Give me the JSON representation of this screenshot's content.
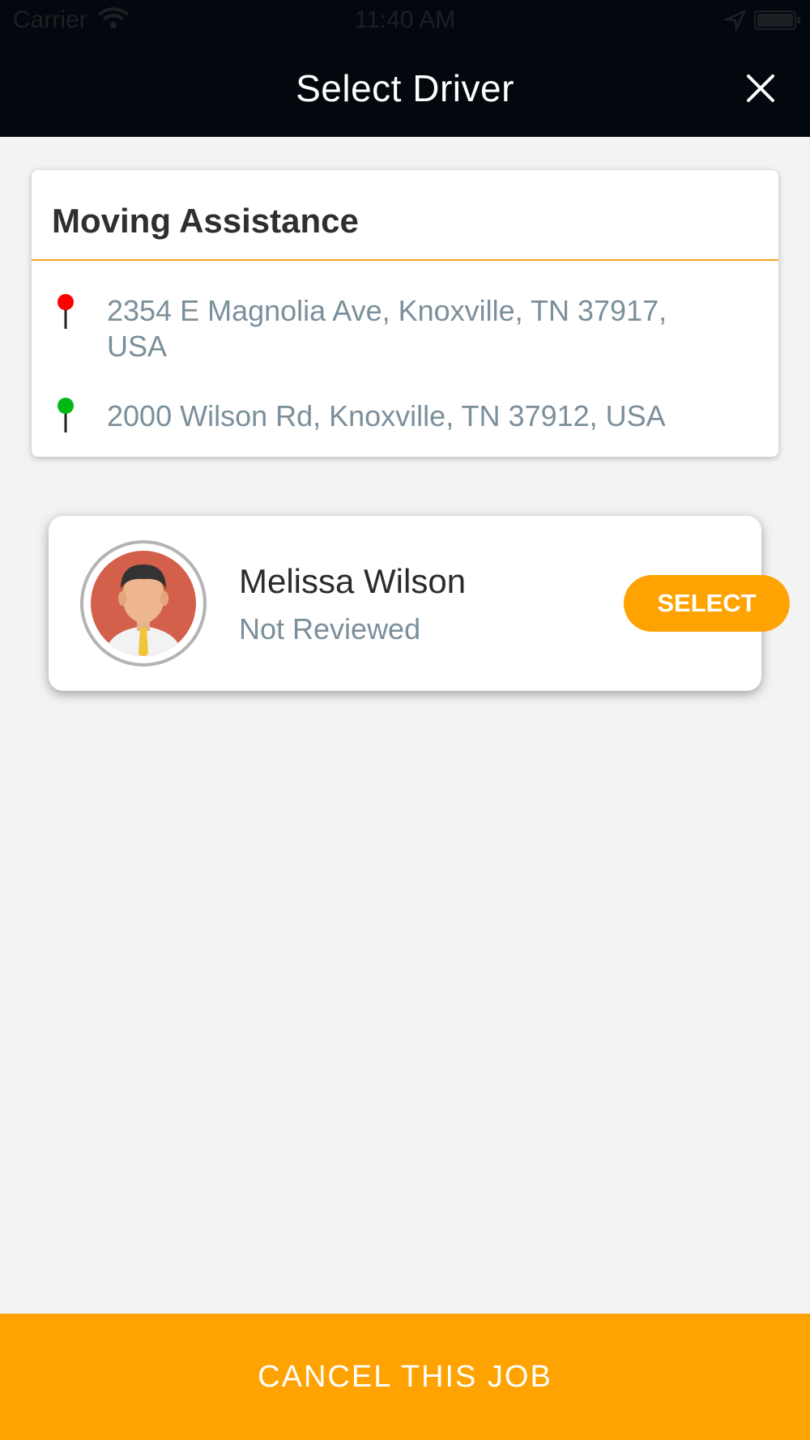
{
  "status_bar": {
    "carrier": "Carrier",
    "time": "11:40 AM"
  },
  "nav": {
    "title": "Select Driver"
  },
  "job": {
    "title": "Moving Assistance",
    "pickup_address": "2354 E Magnolia Ave, Knoxville, TN 37917, USA",
    "dropoff_address": "2000 Wilson Rd, Knoxville, TN 37912, USA"
  },
  "driver": {
    "name": "Melissa Wilson",
    "status": "Not Reviewed",
    "select_label": "SELECT"
  },
  "footer": {
    "cancel_label": "CANCEL THIS JOB"
  },
  "colors": {
    "accent": "#ffa303",
    "header": "#02080d",
    "pickup_pin": "#ff0000",
    "dropoff_pin": "#00b814"
  }
}
